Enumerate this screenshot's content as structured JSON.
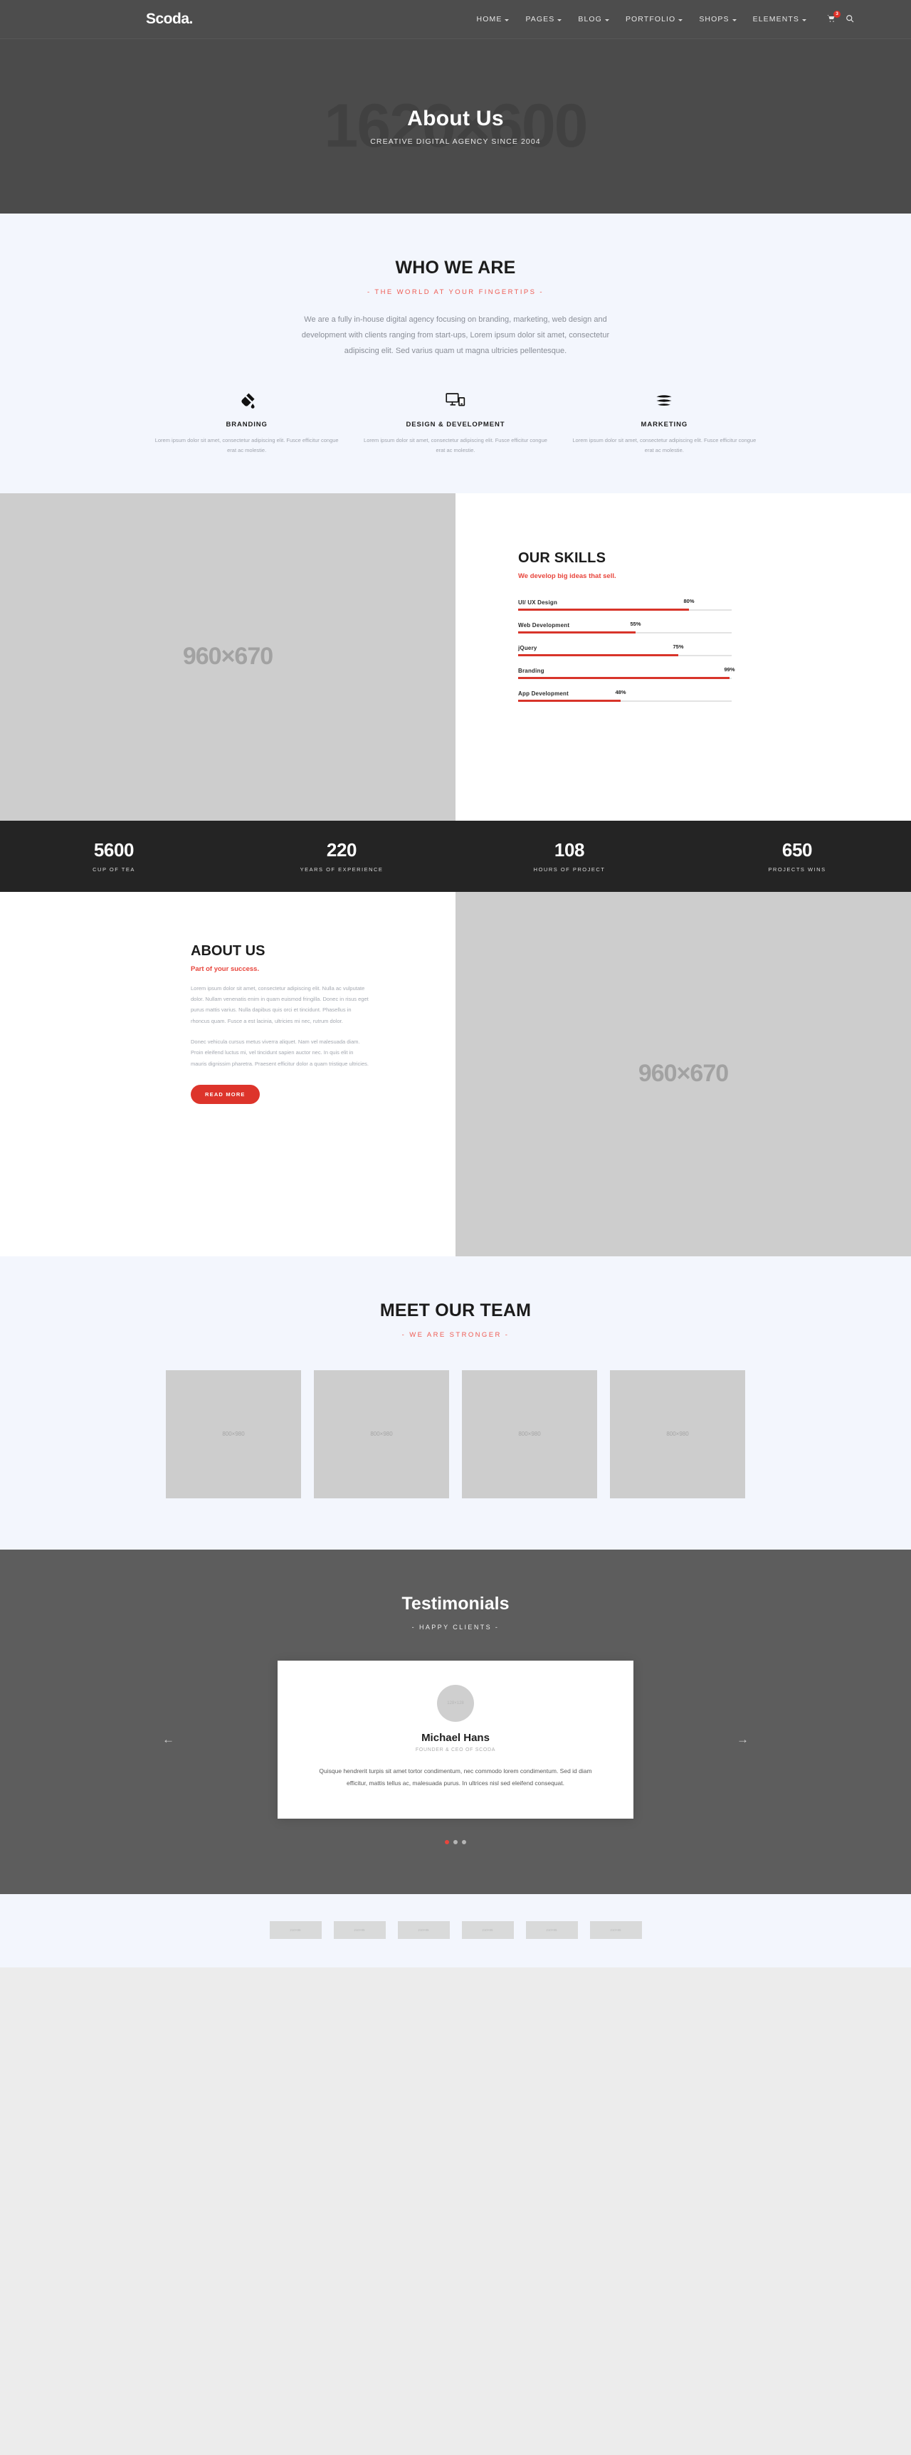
{
  "header": {
    "logo": "Scoda.",
    "nav": [
      {
        "label": "HOME"
      },
      {
        "label": "PAGES"
      },
      {
        "label": "BLOG"
      },
      {
        "label": "PORTFOLIO"
      },
      {
        "label": "SHOPS"
      },
      {
        "label": "ELEMENTS"
      }
    ],
    "cart_count": "3",
    "search_icon": "search-icon",
    "cart_icon": "cart-icon"
  },
  "hero": {
    "placeholder": "1620×600",
    "title": "About Us",
    "subtitle": "CREATIVE DIGITAL AGENCY SINCE 2004"
  },
  "who_we_are": {
    "title": "WHO WE ARE",
    "subtitle": "- THE WORLD AT YOUR FINGERTIPS -",
    "body": "We are a fully in-house digital agency focusing on branding, marketing, web design and development with clients ranging from start-ups, Lorem ipsum dolor sit amet, consectetur adipiscing elit. Sed varius quam ut magna ultricies pellentesque.",
    "services": [
      {
        "icon": "paint-brush-icon",
        "title": "BRANDING",
        "text": "Lorem ipsum dolor sit amet, consectetur adipiscing elit. Fusce efficitur congue erat ac molestie."
      },
      {
        "icon": "monitor-device-icon",
        "title": "DESIGN & DEVELOPMENT",
        "text": "Lorem ipsum dolor sit amet, consectetur adipiscing elit. Fusce efficitur congue erat ac molestie."
      },
      {
        "icon": "megaphone-lines-icon",
        "title": "MARKETING",
        "text": "Lorem ipsum dolor sit amet, consectetur adipiscing elit. Fusce efficitur congue erat ac molestie."
      }
    ]
  },
  "skills": {
    "image_placeholder": "960×670",
    "title": "OUR SKILLS",
    "subtitle": "We develop big ideas that sell.",
    "chart_data": {
      "type": "bar",
      "title": "OUR SKILLS",
      "categories": [
        "UI/ UX Design",
        "Web Development",
        "jQuery",
        "Branding",
        "App Development"
      ],
      "values": [
        80,
        55,
        75,
        99,
        48
      ],
      "value_labels": [
        "80%",
        "55%",
        "75%",
        "99%",
        "48%"
      ],
      "xlabel": "",
      "ylabel": "",
      "ylim": [
        0,
        100
      ],
      "orientation": "horizontal",
      "bar_color": "#d8342a",
      "track_color": "#e3e3e3",
      "grid": false,
      "legend": false
    }
  },
  "counters": [
    {
      "number": "5600",
      "label": "CUP OF TEA"
    },
    {
      "number": "220",
      "label": "YEARS OF EXPERIENCE"
    },
    {
      "number": "108",
      "label": "HOURS OF PROJECT"
    },
    {
      "number": "650",
      "label": "PROJECTS WINS"
    }
  ],
  "about": {
    "title": "ABOUT US",
    "subtitle": "Part of your success.",
    "paragraph1": "Lorem ipsum dolor sit amet, consectetur adipiscing elit. Nulla ac vulputate dolor. Nullam venenatis enim in quam euismod fringilla. Donec in risus eget purus mattis varius. Nulla dapibus quis orci et tincidunt. Phasellus in rhoncus quam. Fusce a est lacinia, ultricies mi nec, rutrum dolor.",
    "paragraph2": "Donec vehicula cursus metus viverra aliquet. Nam vel malesuada diam. Proin eleifend luctus mi, vel tincidunt sapien auctor nec. In quis elit in mauris dignissim pharetra. Praesent efficitur dolor a quam tristique ultricies.",
    "button": "READ MORE",
    "image_placeholder": "960×670"
  },
  "team": {
    "title": "MEET OUR TEAM",
    "subtitle": "- WE ARE STRONGER -",
    "members": [
      {
        "placeholder": "800×980"
      },
      {
        "placeholder": "800×980"
      },
      {
        "placeholder": "800×980"
      },
      {
        "placeholder": "800×980"
      }
    ]
  },
  "testimonials": {
    "title": "Testimonials",
    "subtitle": "- HAPPY CLIENTS -",
    "prev_icon": "arrow-left-icon",
    "next_icon": "arrow-right-icon",
    "slide": {
      "avatar_placeholder": "128×128",
      "name": "Michael Hans",
      "role": "FOUNDER & CEO OF SCODA",
      "quote": "Quisque hendrerit turpis sit amet tortor condimentum, nec commodo lorem condimentum. Sed id diam efficitur, mattis tellus ac, malesuada purus. In ultrices nisl sed eleifend consequat."
    },
    "dots": 3,
    "active_dot": 0
  },
  "clients": [
    {
      "placeholder": "210×85"
    },
    {
      "placeholder": "210×85"
    },
    {
      "placeholder": "210×85"
    },
    {
      "placeholder": "210×85"
    },
    {
      "placeholder": "210×85"
    },
    {
      "placeholder": "210×85"
    }
  ],
  "colors": {
    "accent_red": "#e8453c",
    "button_red": "#dd342b",
    "dark_header": "#4d4d4d",
    "counters_bg": "#242424",
    "light_bg": "#f3f6fd"
  }
}
